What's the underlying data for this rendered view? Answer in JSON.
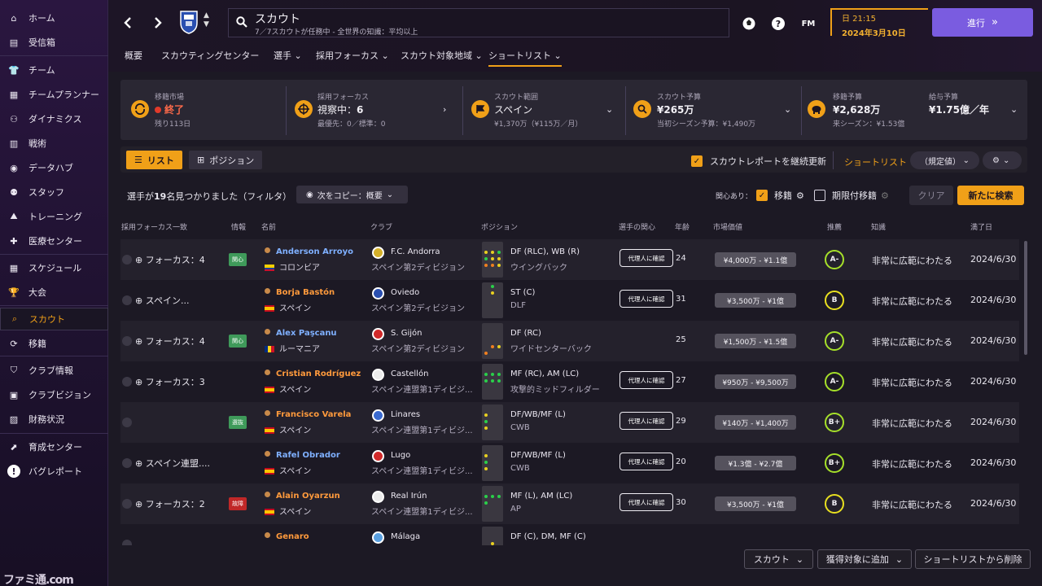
{
  "sidebar": {
    "items": [
      {
        "label": "ホーム",
        "icon": "home-icon"
      },
      {
        "label": "受信箱",
        "icon": "inbox-icon"
      },
      {
        "label": "チーム",
        "icon": "shirt-icon"
      },
      {
        "label": "チームプランナー",
        "icon": "clipboard-icon"
      },
      {
        "label": "ダイナミクス",
        "icon": "people-icon"
      },
      {
        "label": "戦術",
        "icon": "tactics-icon"
      },
      {
        "label": "データハブ",
        "icon": "data-icon"
      },
      {
        "label": "スタッフ",
        "icon": "staff-icon"
      },
      {
        "label": "トレーニング",
        "icon": "training-icon"
      },
      {
        "label": "医療センター",
        "icon": "medical-icon"
      },
      {
        "label": "スケジュール",
        "icon": "calendar-icon"
      },
      {
        "label": "大会",
        "icon": "trophy-icon"
      },
      {
        "label": "スカウト",
        "icon": "scout-icon"
      },
      {
        "label": "移籍",
        "icon": "transfer-icon"
      },
      {
        "label": "クラブ情報",
        "icon": "shield-icon"
      },
      {
        "label": "クラブビジョン",
        "icon": "briefcase-icon"
      },
      {
        "label": "財務状況",
        "icon": "finance-icon"
      },
      {
        "label": "育成センター",
        "icon": "growth-icon"
      },
      {
        "label": "バグレポート",
        "icon": "alert-icon"
      }
    ],
    "logo": "ファミ通.com"
  },
  "header": {
    "title": "スカウト",
    "subtitle": "7／7スカウトが任務中 - 全世界の知識：平均以上",
    "time": "日 21:15",
    "date": "2024年3月10日",
    "go_label": "進行",
    "fm_label": "FM"
  },
  "tabs": [
    "概要",
    "スカウティングセンター",
    "選手",
    "採用フォーカス",
    "スカウト対象地域",
    "ショートリスト"
  ],
  "summary": {
    "market": {
      "label": "移籍市場",
      "value": "終了",
      "sub": "残り113日"
    },
    "focus": {
      "label": "採用フォーカス",
      "value_prefix": "視察中：",
      "value_num": "6",
      "sub": "最優先：0／標準：0"
    },
    "range": {
      "label": "スカウト範囲",
      "value": "スペイン",
      "sub": "¥1,370万（¥115万／月）"
    },
    "scout_budget": {
      "label": "スカウト予算",
      "value": "¥265万",
      "sub": "当初シーズン予算：¥1,490万"
    },
    "transfer_budget": {
      "label": "移籍予算",
      "value": "¥2,628万",
      "sub": "来シーズン：¥1.53億"
    },
    "wage_budget": {
      "label": "給与予算",
      "value": "¥1.75億／年"
    }
  },
  "toolbar": {
    "list_label": "リスト",
    "position_label": "ポジション",
    "keep_update_label": "スカウトレポートを継続更新",
    "shortlist_label": "ショートリスト",
    "default_label": "（規定値）"
  },
  "filterbar": {
    "found_pre": "選手が",
    "found_num": "19",
    "found_post": "名見つかりました（フィルタ）",
    "copy_label": "次をコピー：概要",
    "interest_label": "関心あり：",
    "transfer_label": "移籍",
    "loan_label": "期限付移籍",
    "clear_label": "クリア",
    "new_search_label": "新たに検索"
  },
  "columns": [
    "採用フォーカス一致",
    "情報",
    "名前",
    "クラブ",
    "ポジション",
    "選手の関心",
    "年齢",
    "市場価値",
    "推薦",
    "知識",
    "満了日"
  ],
  "players": [
    {
      "focus": "フォーカス：4",
      "info": "関心",
      "info_color": "#3f9a5a",
      "name": "Anderson Arroyo",
      "name_color": "blue",
      "nat": "コロンビア",
      "club": "F.C. Andorra",
      "league": "スペイン第2ディビジョン",
      "pos": "DF (RLC), WB (R)",
      "role": "ウイングバック",
      "interest": "代理人に確認",
      "age": "24",
      "value": "¥4,000万 - ¥1.1億",
      "rec": "A-",
      "rec_color": "g",
      "knowledge": "非常に広範にわたる",
      "expiry": "2024/6/30"
    },
    {
      "focus": "スペイン...",
      "info": "",
      "name": "Borja Bastón",
      "name_color": "orange",
      "nat": "スペイン",
      "club": "Oviedo",
      "league": "スペイン第2ディビジョン",
      "pos": "ST (C)",
      "role": "DLF",
      "interest": "代理人に確認",
      "age": "31",
      "value": "¥3,500万 - ¥1億",
      "rec": "B",
      "rec_color": "y",
      "knowledge": "非常に広範にわたる",
      "expiry": "2024/6/30"
    },
    {
      "focus": "フォーカス：4",
      "info": "関心",
      "info_color": "#3f9a5a",
      "name": "Alex Paşcanu",
      "name_color": "blue",
      "nat": "ルーマニア",
      "club": "S. Gijón",
      "league": "スペイン第2ディビジョン",
      "pos": "DF (RC)",
      "role": "ワイドセンターバック",
      "interest": "",
      "age": "25",
      "value": "¥1,500万 - ¥1.5億",
      "rec": "A-",
      "rec_color": "g",
      "knowledge": "非常に広範にわたる",
      "expiry": "2024/6/30"
    },
    {
      "focus": "フォーカス：3",
      "info": "",
      "name": "Cristian Rodríguez",
      "name_color": "orange",
      "nat": "スペイン",
      "club": "Castellón",
      "league": "スペイン連盟第1ディビジ...",
      "pos": "MF (RC), AM (LC)",
      "role": "攻撃的ミッドフィルダー",
      "interest": "代理人に確認",
      "age": "27",
      "value": "¥950万 - ¥9,500万",
      "rec": "A-",
      "rec_color": "g",
      "knowledge": "非常に広範にわたる",
      "expiry": "2024/6/30"
    },
    {
      "focus": "",
      "info": "選抜",
      "info_color": "#3f9a5a",
      "name": "Francisco Varela",
      "name_color": "orange",
      "nat": "スペイン",
      "club": "Linares",
      "league": "スペイン連盟第1ディビジ...",
      "pos": "DF/WB/MF (L)",
      "role": "CWB",
      "interest": "代理人に確認",
      "age": "29",
      "value": "¥140万 - ¥1,400万",
      "rec": "B+",
      "rec_color": "g",
      "knowledge": "非常に広範にわたる",
      "expiry": "2024/6/30"
    },
    {
      "focus": "スペイン連盟....",
      "info": "",
      "name": "Rafel Obrador",
      "name_color": "blue",
      "nat": "スペイン",
      "club": "Lugo",
      "league": "スペイン連盟第1ディビジ...",
      "pos": "DF/WB/MF (L)",
      "role": "CWB",
      "interest": "代理人に確認",
      "age": "20",
      "value": "¥1.3億 - ¥2.7億",
      "rec": "B+",
      "rec_color": "g",
      "knowledge": "非常に広範にわたる",
      "expiry": "2024/6/30"
    },
    {
      "focus": "フォーカス：2",
      "info": "故障",
      "info_color": "#c02828",
      "name": "Alain Oyarzun",
      "name_color": "orange",
      "nat": "スペイン",
      "club": "Real Irún",
      "league": "スペイン連盟第1ディビジ...",
      "pos": "MF (L), AM (LC)",
      "role": "AP",
      "interest": "代理人に確認",
      "age": "30",
      "value": "¥3,500万 - ¥1億",
      "rec": "B",
      "rec_color": "y",
      "knowledge": "非常に広範にわたる",
      "expiry": "2024/6/30"
    },
    {
      "focus": "",
      "info": "",
      "name": "Genaro",
      "name_color": "orange",
      "nat": "",
      "club": "Málaga",
      "league": "",
      "pos": "DF (C), DM, MF (C)",
      "role": "",
      "interest": "",
      "age": "",
      "value": "",
      "rec": "",
      "rec_color": "g",
      "knowledge": "",
      "expiry": ""
    }
  ],
  "bottom": {
    "scout_label": "スカウト",
    "add_target_label": "獲得対象に追加",
    "remove_label": "ショートリストから削除"
  }
}
